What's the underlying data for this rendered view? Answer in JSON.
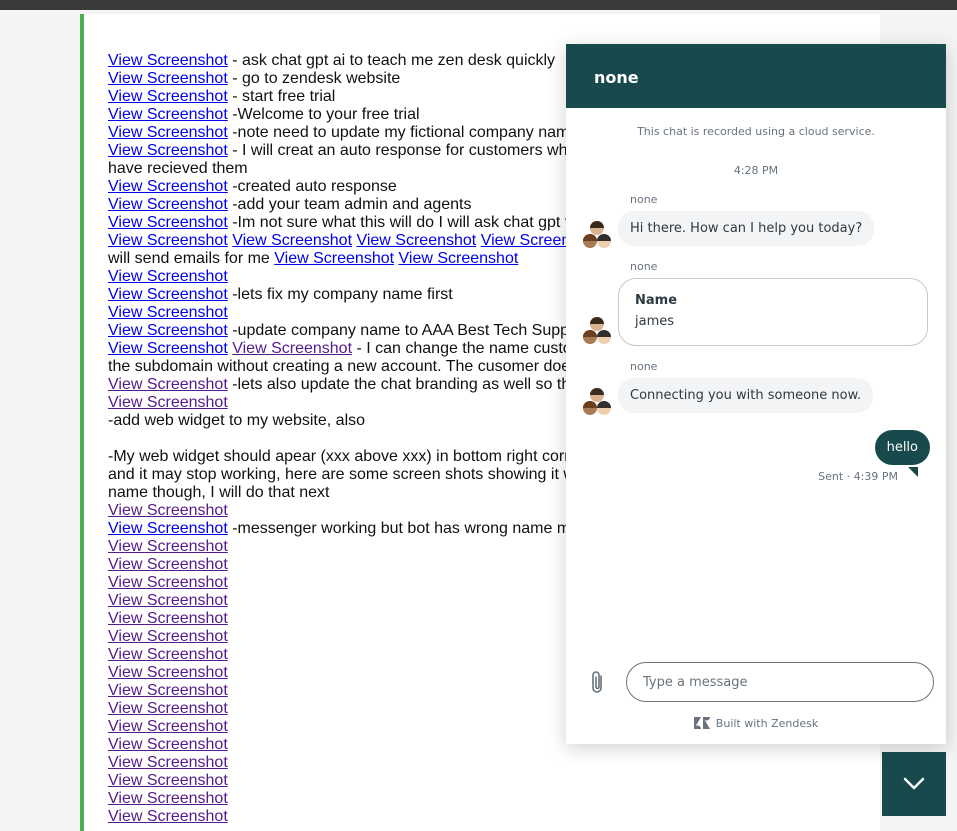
{
  "document": {
    "lines": [
      [
        {
          "link": "View Screenshot"
        },
        {
          "text": " - ask chat gpt ai to teach me zen desk quickly"
        }
      ],
      [
        {
          "link": "View Screenshot"
        },
        {
          "text": " - go to zendesk website"
        }
      ],
      [
        {
          "link": "View Screenshot"
        },
        {
          "text": " - start free trial"
        }
      ],
      [
        {
          "link": "View Screenshot"
        },
        {
          "text": " -Welcome to your free trial"
        }
      ],
      [
        {
          "link": "View Screenshot"
        },
        {
          "text": " -note need to update my fictional company nam"
        }
      ],
      [
        {
          "link": "View Screenshot"
        },
        {
          "text": " - I will creat an auto response for customers who"
        }
      ],
      [
        {
          "text": "have recieved them"
        }
      ],
      [
        {
          "link": "View Screenshot"
        },
        {
          "text": " -created auto response"
        }
      ],
      [
        {
          "link": "View Screenshot"
        },
        {
          "text": " -add your team admin and agents"
        }
      ],
      [
        {
          "link": "View Screenshot"
        },
        {
          "text": " -Im not sure what this will do I will ask chat gpt f"
        }
      ],
      [
        {
          "link": "View Screenshot"
        },
        {
          "text": " "
        },
        {
          "link": "View Screenshot"
        },
        {
          "text": " "
        },
        {
          "link": "View Screenshot"
        },
        {
          "text": " "
        },
        {
          "link": "View Screen"
        }
      ],
      [
        {
          "text": "will send emails for me "
        },
        {
          "link": "View Screenshot"
        },
        {
          "text": " "
        },
        {
          "link": "View Screenshot"
        }
      ],
      [
        {
          "link": "View Screenshot"
        }
      ],
      [
        {
          "link": "View Screenshot"
        },
        {
          "text": " -lets fix my company name first"
        }
      ],
      [
        {
          "link": "View Screenshot"
        }
      ],
      [
        {
          "link": "View Screenshot"
        },
        {
          "text": " -update company name to AAA Best Tech Supp"
        }
      ],
      [
        {
          "link": "View Screenshot"
        },
        {
          "text": " "
        },
        {
          "link": "View Screenshot",
          "visited": true
        },
        {
          "text": " - I can change the name custo"
        }
      ],
      [
        {
          "text": "the subdomain without creating a new account. The cusomer doe"
        }
      ],
      [
        {
          "link": "View Screenshot",
          "visited": true
        },
        {
          "text": " -lets also update the chat branding as well so th"
        }
      ],
      [
        {
          "link": "View Screenshot",
          "visited": true
        }
      ],
      [
        {
          "text": "-add web widget to my website, also"
        }
      ],
      [],
      [
        {
          "text": "-My web widget should apear (xxx above xxx) in bottom right corn"
        }
      ],
      [
        {
          "text": "and it may stop working, here are some screen shots showing it w"
        }
      ],
      [
        {
          "text": "name though, I will do that next"
        }
      ],
      [
        {
          "link": "View Screenshot",
          "visited": true
        }
      ],
      [
        {
          "link": "View Screenshot"
        },
        {
          "text": " -messenger working but bot has wrong name m"
        }
      ],
      [
        {
          "link": "View Screenshot",
          "visited": true
        }
      ],
      [
        {
          "link": "View Screenshot",
          "visited": true
        }
      ],
      [
        {
          "link": "View Screenshot",
          "visited": true
        }
      ],
      [
        {
          "link": "View Screenshot",
          "visited": true
        }
      ],
      [
        {
          "link": "View Screenshot",
          "visited": true
        }
      ],
      [
        {
          "link": "View Screenshot",
          "visited": true
        }
      ],
      [
        {
          "link": "View Screenshot",
          "visited": true
        }
      ],
      [
        {
          "link": "View Screenshot",
          "visited": true
        }
      ],
      [
        {
          "link": "View Screenshot",
          "visited": true
        }
      ],
      [
        {
          "link": "View Screenshot",
          "visited": true
        }
      ],
      [
        {
          "link": "View Screenshot",
          "visited": true
        }
      ],
      [
        {
          "link": "View Screenshot",
          "visited": true
        }
      ],
      [
        {
          "link": "View Screenshot",
          "visited": true
        }
      ],
      [
        {
          "link": "View Screenshot",
          "visited": true
        }
      ],
      [
        {
          "link": "View Screenshot",
          "visited": true
        }
      ],
      [
        {
          "link": "View Screenshot",
          "visited": true
        }
      ]
    ]
  },
  "widget": {
    "title": "none",
    "notice": "This chat is recorded using a cloud service.",
    "timestamp": "4:28 PM",
    "messages": [
      {
        "sender": "none",
        "text": "Hi there. How can I help you today?"
      },
      {
        "sender": "none",
        "form_label": "Name",
        "form_value": "james"
      },
      {
        "sender": "none",
        "text": "Connecting you with someone now."
      }
    ],
    "outgoing": {
      "text": "hello",
      "status": "Sent · 4:39 PM"
    },
    "input_placeholder": "Type a message",
    "branding": "Built with Zendesk"
  },
  "icons": {
    "attach": "paperclip-icon",
    "launcher": "chevron-down-icon",
    "brand": "zendesk-logo-icon",
    "avatar": "agent-group-avatar"
  },
  "colors": {
    "header": "#17494d",
    "link": "#0000ee",
    "visited_link": "#551a8b",
    "doc_border": "#4caf50"
  }
}
